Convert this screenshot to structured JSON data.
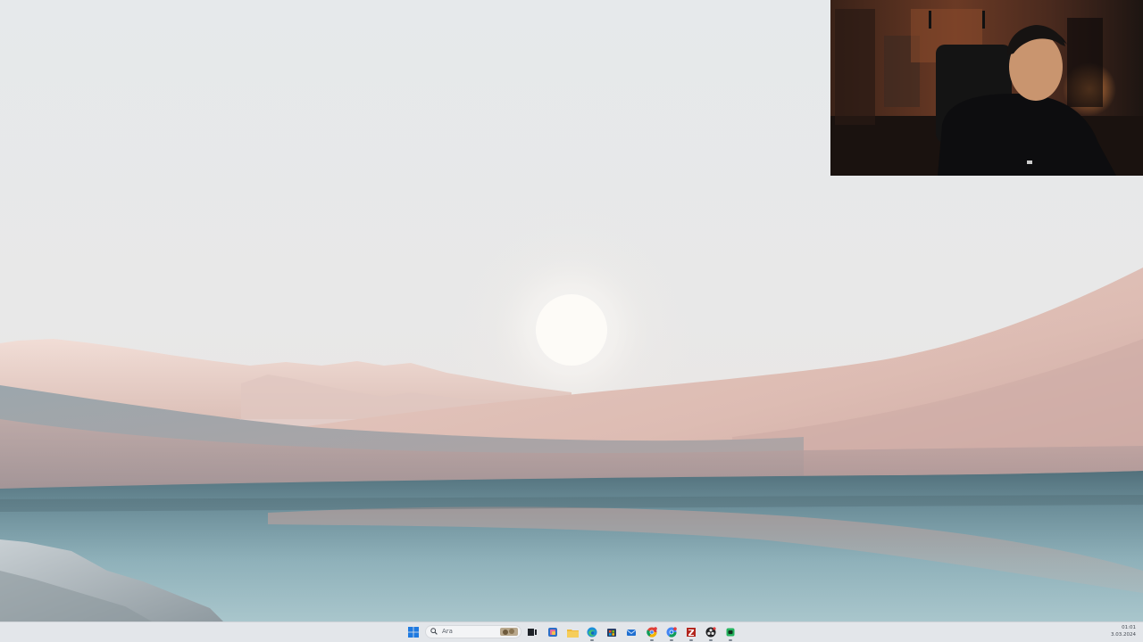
{
  "taskbar": {
    "search": {
      "placeholder": "Ara"
    },
    "pinned_apps": [
      {
        "name": "start-icon",
        "label": ""
      },
      {
        "name": "search-icon",
        "label": ""
      },
      {
        "name": "task-view-icon",
        "label": ""
      },
      {
        "name": "copilot-icon",
        "label": ""
      },
      {
        "name": "file-explorer-icon",
        "label": ""
      },
      {
        "name": "edge-icon",
        "label": ""
      },
      {
        "name": "store-icon",
        "label": ""
      },
      {
        "name": "mail-icon",
        "label": ""
      },
      {
        "name": "chrome-icon",
        "label": ""
      },
      {
        "name": "chrome-profile-icon",
        "label": ""
      },
      {
        "name": "filezilla-icon",
        "label": ""
      },
      {
        "name": "obs-icon",
        "label": ""
      },
      {
        "name": "app-green-icon",
        "label": ""
      }
    ],
    "clock": {
      "time": "01:01",
      "date": "3.03.2024"
    }
  },
  "colors": {
    "taskbar_bg": "#e3e6ea",
    "windows_blue": "#1f7ae0",
    "sky": "#e7eaec",
    "dune": "#d9b8b0",
    "water": "#7c9aa4"
  }
}
